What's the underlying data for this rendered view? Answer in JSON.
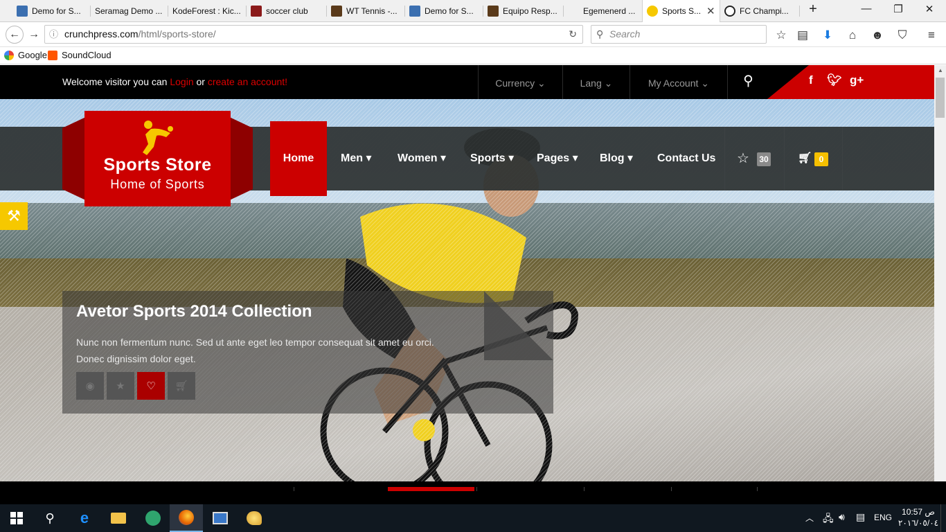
{
  "browser": {
    "tabs": [
      {
        "title": "Demo for S...",
        "active": false
      },
      {
        "title": "Seramag Demo ...",
        "active": false
      },
      {
        "title": "KodeForest : Kic...",
        "active": false
      },
      {
        "title": "soccer club",
        "active": false
      },
      {
        "title": "WT Tennis -...",
        "active": false
      },
      {
        "title": "Demo for S...",
        "active": false
      },
      {
        "title": "Equipo Resp...",
        "active": false
      },
      {
        "title": "Egemenerd ...",
        "active": false
      },
      {
        "title": "Sports S...",
        "active": true
      },
      {
        "title": "FC Champi...",
        "active": false
      }
    ],
    "url_host": "crunchpress.com",
    "url_path": "/html/sports-store/",
    "search_placeholder": "Search",
    "bookmarks": [
      "Google",
      "SoundCloud"
    ]
  },
  "site": {
    "welcome_prefix": "Welcome visitor you can",
    "login": "Login",
    "or": "or",
    "create_account": "create an account!",
    "currency": "Currency",
    "lang": "Lang",
    "my_account": "My Account",
    "logo_title": "Sports Store",
    "logo_subtitle": "Home of Sports",
    "nav": [
      "Home",
      "Men",
      "Women",
      "Sports",
      "Pages",
      "Blog",
      "Contact Us"
    ],
    "wishlist_count": "30",
    "cart_count": "0",
    "slide_title": "Avetor Sports 2014 Collection",
    "slide_text": "Nunc non fermentum nunc. Sed ut ante eget leo tempor consequat sit amet eu orci. Donec dignissim dolor eget.",
    "slider_active_index": 1
  },
  "taskbar": {
    "clock_time": "10:57 ص",
    "clock_date": "٢٠١٦/٠٥/٠٤",
    "lang": "ENG"
  },
  "colors": {
    "brand_red": "#cc0000",
    "badge_gray": "#8a8a8a",
    "badge_yellow": "#f6c000"
  }
}
